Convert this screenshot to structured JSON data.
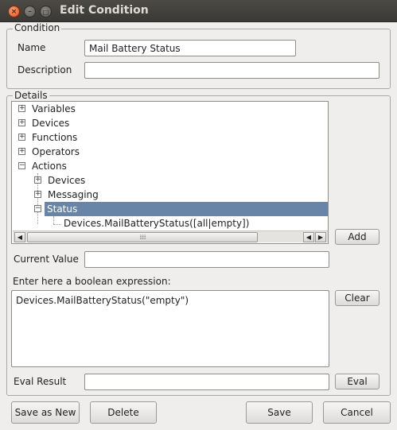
{
  "window": {
    "title": "Edit Condition",
    "controls": {
      "close": "×",
      "minimize": "–",
      "maximize": "□"
    }
  },
  "condition": {
    "group_label": "Condition",
    "name_label": "Name",
    "name_value": "Mail Battery Status",
    "description_label": "Description",
    "description_value": ""
  },
  "details": {
    "group_label": "Details",
    "tree": [
      {
        "label": "Variables",
        "expander": "+"
      },
      {
        "label": "Devices",
        "expander": "+"
      },
      {
        "label": "Functions",
        "expander": "+"
      },
      {
        "label": "Operators",
        "expander": "+"
      },
      {
        "label": "Actions",
        "expander": "−"
      },
      {
        "label": "Devices",
        "expander": "+"
      },
      {
        "label": "Messaging",
        "expander": "+"
      },
      {
        "label": "Status",
        "expander": "−"
      },
      {
        "label": "Devices.MailBatteryStatus([all|empty])",
        "expander": ""
      }
    ],
    "scroll": {
      "left": "◀",
      "right": "▶",
      "grip": "⁞⁞⁞⁞⁞"
    },
    "add_label": "Add",
    "current_value_label": "Current Value",
    "current_value": "",
    "expression_label": "Enter here a boolean expression:",
    "expression_value": "Devices.MailBatteryStatus(\"empty\")",
    "clear_label": "Clear",
    "eval_result_label": "Eval Result",
    "eval_result_value": "",
    "eval_label": "Eval"
  },
  "footer": {
    "save_as_new": "Save as New",
    "delete": "Delete",
    "save": "Save",
    "cancel": "Cancel"
  }
}
